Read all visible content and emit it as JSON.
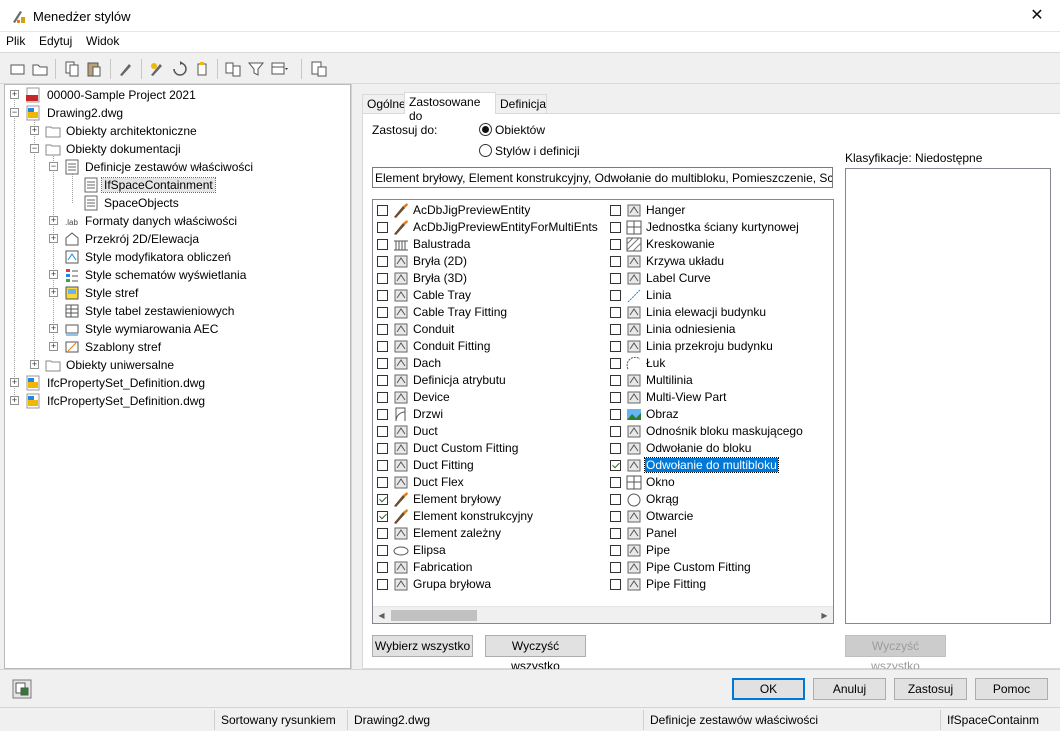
{
  "window": {
    "title": "Menedżer stylów",
    "close_glyph": "✕"
  },
  "menu": {
    "items": [
      "Plik",
      "Edytuj",
      "Widok"
    ]
  },
  "toolbar": {
    "icons": [
      "new-icon",
      "open-icon",
      "copy-icon",
      "paste-icon",
      "purge-icon",
      "edit-style-icon",
      "rename-icon",
      "send-icon",
      "compare-icon",
      "filter-icon",
      "view-icon",
      "toggle-view-icon"
    ]
  },
  "tree": {
    "nodes": [
      "00000-Sample Project 2021",
      "Drawing2.dwg",
      "Obiekty architektoniczne",
      "Obiekty dokumentacji",
      "Definicje zestawów właściwości",
      "IfSpaceContainment",
      "SpaceObjects",
      "Formaty danych właściwości",
      "Przekrój 2D/Elewacja",
      "Style modyfikatora obliczeń",
      "Style schematów wyświetlania",
      "Style stref",
      "Style tabel zestawieniowych",
      "Style wymiarowania AEC",
      "Szablony stref",
      "Obiekty uniwersalne",
      "IfcPropertySet_Definition.dwg",
      "IfcPropertySet_Definition.dwg"
    ]
  },
  "tabs": [
    "Ogólne",
    "Zastosowane do",
    "Definicja"
  ],
  "applied": {
    "apply_to_label": "Zastosuj do:",
    "radio_objects": "Obiektów",
    "radio_styles": "Stylów i definicji",
    "summary": "Element bryłowy, Element konstrukcyjny, Odwołanie do multibloku, Pomieszczenie, Schody",
    "col1": [
      {
        "label": "AcDbJigPreviewEntity",
        "checked": false,
        "icon": "brush-icon"
      },
      {
        "label": "AcDbJigPreviewEntityForMultiEnts",
        "checked": false,
        "icon": "brush-icon"
      },
      {
        "label": "Balustrada",
        "checked": false,
        "icon": "railing-icon"
      },
      {
        "label": "Bryła (2D)",
        "checked": false,
        "icon": "mass-2d-icon"
      },
      {
        "label": "Bryła (3D)",
        "checked": false,
        "icon": "mass-3d-icon"
      },
      {
        "label": "Cable Tray",
        "checked": false,
        "icon": "cable-tray-icon"
      },
      {
        "label": "Cable Tray Fitting",
        "checked": false,
        "icon": "cable-tray-fitting-icon"
      },
      {
        "label": "Conduit",
        "checked": false,
        "icon": "conduit-icon"
      },
      {
        "label": "Conduit Fitting",
        "checked": false,
        "icon": "conduit-fitting-icon"
      },
      {
        "label": "Dach",
        "checked": false,
        "icon": "roof-icon"
      },
      {
        "label": "Definicja atrybutu",
        "checked": false,
        "icon": "attribute-icon"
      },
      {
        "label": "Device",
        "checked": false,
        "icon": "device-icon"
      },
      {
        "label": "Drzwi",
        "checked": false,
        "icon": "door-icon"
      },
      {
        "label": "Duct",
        "checked": false,
        "icon": "duct-icon"
      },
      {
        "label": "Duct Custom Fitting",
        "checked": false,
        "icon": "duct-custom-fitting-icon"
      },
      {
        "label": "Duct Fitting",
        "checked": false,
        "icon": "duct-fitting-icon"
      },
      {
        "label": "Duct Flex",
        "checked": false,
        "icon": "duct-flex-icon"
      },
      {
        "label": "Element bryłowy",
        "checked": true,
        "icon": "brush-icon"
      },
      {
        "label": "Element konstrukcyjny",
        "checked": true,
        "icon": "brush-icon"
      },
      {
        "label": "Element zależny",
        "checked": false,
        "icon": "dependent-icon"
      },
      {
        "label": "Elipsa",
        "checked": false,
        "icon": "ellipse-icon"
      },
      {
        "label": "Fabrication",
        "checked": false,
        "icon": "fabrication-icon"
      },
      {
        "label": "Grupa bryłowa",
        "checked": false,
        "icon": "mass-group-icon"
      }
    ],
    "col2": [
      {
        "label": "Hanger",
        "checked": false,
        "icon": "hanger-icon"
      },
      {
        "label": "Jednostka ściany kurtynowej",
        "checked": false,
        "icon": "curtain-wall-unit-icon"
      },
      {
        "label": "Kreskowanie",
        "checked": false,
        "icon": "hatch-icon"
      },
      {
        "label": "Krzywa układu",
        "checked": false,
        "icon": "layout-curve-icon"
      },
      {
        "label": "Label Curve",
        "checked": false,
        "icon": "label-curve-icon"
      },
      {
        "label": "Linia",
        "checked": false,
        "icon": "line-icon"
      },
      {
        "label": "Linia elewacji budynku",
        "checked": false,
        "icon": "elevation-line-icon"
      },
      {
        "label": "Linia odniesienia",
        "checked": false,
        "icon": "leader-line-icon"
      },
      {
        "label": "Linia przekroju budynku",
        "checked": false,
        "icon": "section-line-icon"
      },
      {
        "label": "Łuk",
        "checked": false,
        "icon": "arc-icon"
      },
      {
        "label": "Multilinia",
        "checked": false,
        "icon": "multiline-icon"
      },
      {
        "label": "Multi-View Part",
        "checked": false,
        "icon": "mvpart-icon"
      },
      {
        "label": "Obraz",
        "checked": false,
        "icon": "image-icon"
      },
      {
        "label": "Odnośnik bloku maskującego",
        "checked": false,
        "icon": "mask-block-icon"
      },
      {
        "label": "Odwołanie do bloku",
        "checked": false,
        "icon": "block-ref-icon"
      },
      {
        "label": "Odwołanie do multibloku",
        "checked": true,
        "selected": true,
        "icon": "multiview-block-icon"
      },
      {
        "label": "Okno",
        "checked": false,
        "icon": "window-icon"
      },
      {
        "label": "Okrąg",
        "checked": false,
        "icon": "circle-icon"
      },
      {
        "label": "Otwarcie",
        "checked": false,
        "icon": "opening-icon"
      },
      {
        "label": "Panel",
        "checked": false,
        "icon": "panel-icon"
      },
      {
        "label": "Pipe",
        "checked": false,
        "icon": "pipe-icon"
      },
      {
        "label": "Pipe Custom Fitting",
        "checked": false,
        "icon": "pipe-custom-fitting-icon"
      },
      {
        "label": "Pipe Fitting",
        "checked": false,
        "icon": "pipe-fitting-icon"
      }
    ],
    "select_all": "Wybierz wszystko",
    "clear_all": "Wyczyść wszystko",
    "classifications_label": "Klasyfikacje: Niedostępne",
    "clear_all_disabled": "Wyczyść wszystko"
  },
  "dialog_buttons": {
    "ok": "OK",
    "cancel": "Anuluj",
    "apply": "Zastosuj",
    "help": "Pomoc"
  },
  "status": {
    "sort": "Sortowany rysunkiem",
    "drawing": "Drawing2.dwg",
    "category": "Definicje zestawów właściwości",
    "item": "IfSpaceContainm"
  }
}
